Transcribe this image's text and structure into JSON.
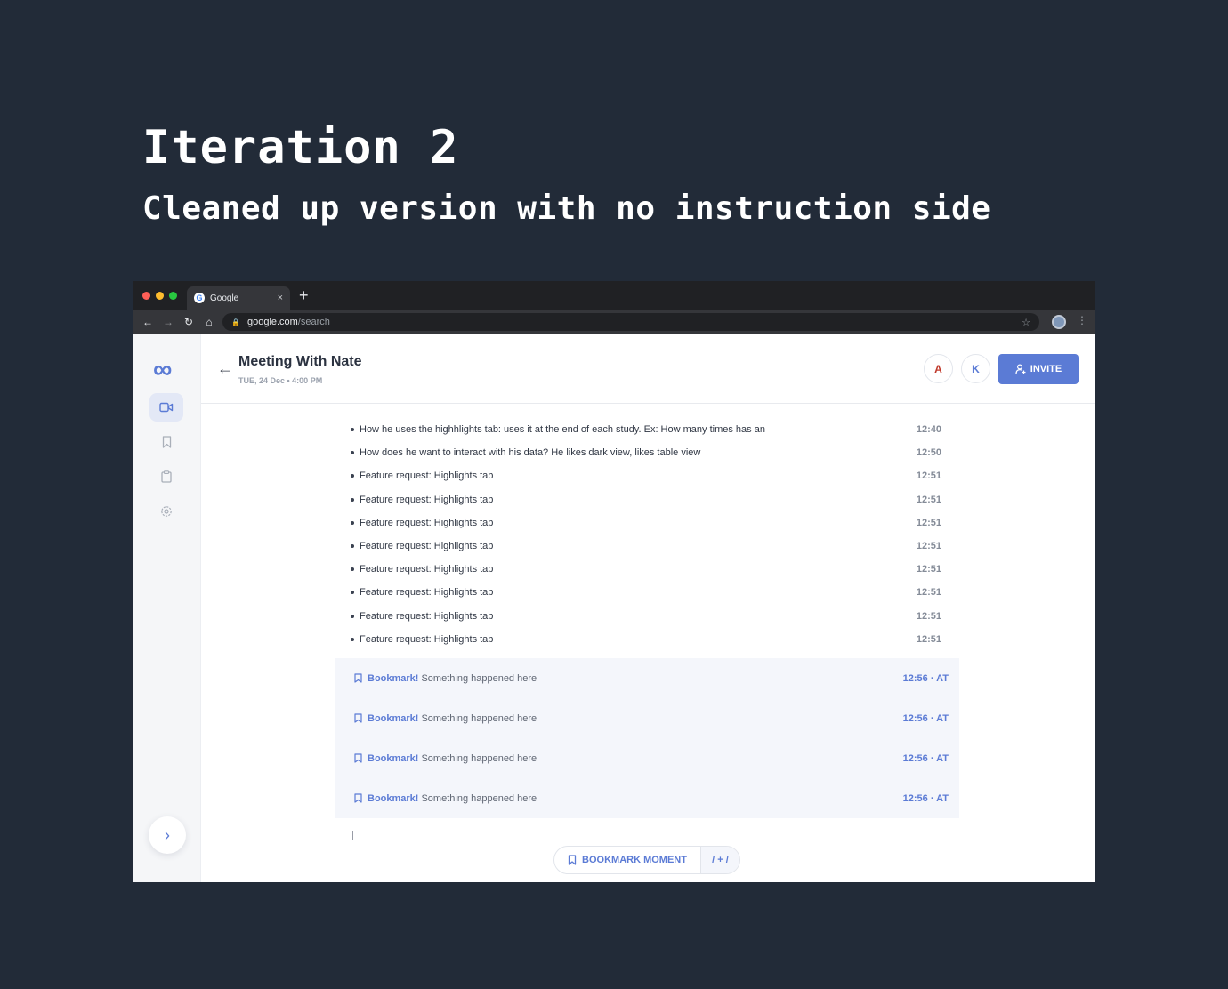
{
  "hero": {
    "title": "Iteration 2",
    "subtitle": "Cleaned up version with no instruction side"
  },
  "browser": {
    "tab_title": "Google",
    "tab_close": "×",
    "new_tab": "+",
    "url_host": "google.com",
    "url_path": "/search",
    "traffic_lights": [
      "#ff5f57",
      "#febc2e",
      "#28c840"
    ]
  },
  "app": {
    "logo": "∞",
    "meeting_title": "Meeting With Nate",
    "meeting_date": "TUE, 24 Dec • 4:00 PM",
    "avatars": [
      {
        "initial": "A",
        "color": "#c0392b"
      },
      {
        "initial": "K",
        "color": "#5b7bd5"
      }
    ],
    "invite_label": "INVITE",
    "notes": [
      {
        "text": "How he uses the highhlights tab: uses it at the end of each study. Ex: How many times has an",
        "time": "12:40"
      },
      {
        "text": "How does he want to interact with his data? He likes dark view, likes table view",
        "time": "12:50"
      },
      {
        "text": "Feature request: Highlights tab",
        "time": "12:51"
      },
      {
        "text": "Feature request: Highlights tab",
        "time": "12:51"
      },
      {
        "text": "Feature request: Highlights tab",
        "time": "12:51"
      },
      {
        "text": "Feature request: Highlights tab",
        "time": "12:51"
      },
      {
        "text": "Feature request: Highlights tab",
        "time": "12:51"
      },
      {
        "text": "Feature request: Highlights tab",
        "time": "12:51"
      },
      {
        "text": "Feature request: Highlights tab",
        "time": "12:51"
      },
      {
        "text": "Feature request: Highlights tab",
        "time": "12:51"
      }
    ],
    "bookmarks": [
      {
        "label": "Bookmark!",
        "text": "Something happened here",
        "time": "12:56 · AT"
      },
      {
        "label": "Bookmark!",
        "text": "Something happened here",
        "time": "12:56 · AT"
      },
      {
        "label": "Bookmark!",
        "text": "Something happened here",
        "time": "12:56 · AT"
      },
      {
        "label": "Bookmark!",
        "text": "Something happened here",
        "time": "12:56 · AT"
      }
    ],
    "cursor": "|",
    "bookmark_button_label": "BOOKMARK MOMENT",
    "bookmark_shortcut": "/ + /",
    "accent_color": "#5b7bd5"
  }
}
